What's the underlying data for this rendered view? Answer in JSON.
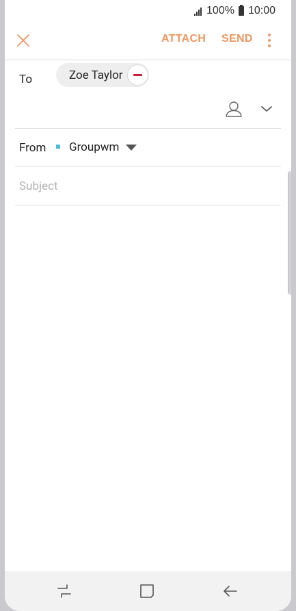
{
  "status_bar": {
    "battery": "100%",
    "time": "10:00"
  },
  "app_bar": {
    "attach_label": "ATTACH",
    "send_label": "SEND"
  },
  "recipients": {
    "to_label": "To",
    "chips": [
      {
        "name": "Zoe Taylor"
      }
    ]
  },
  "from": {
    "label": "From",
    "account": "Groupwm"
  },
  "subject": {
    "value": "",
    "placeholder": "Subject"
  },
  "colors": {
    "accent": "#f0965e",
    "remove": "#cc2233",
    "account_dot": "#4bb8e0"
  },
  "icons": [
    "signal-icon",
    "battery-icon",
    "close-icon",
    "more-icon",
    "remove-icon",
    "contacts-icon",
    "chevron-down-icon",
    "caret-down-icon",
    "recent-apps-icon",
    "home-icon",
    "back-icon"
  ]
}
